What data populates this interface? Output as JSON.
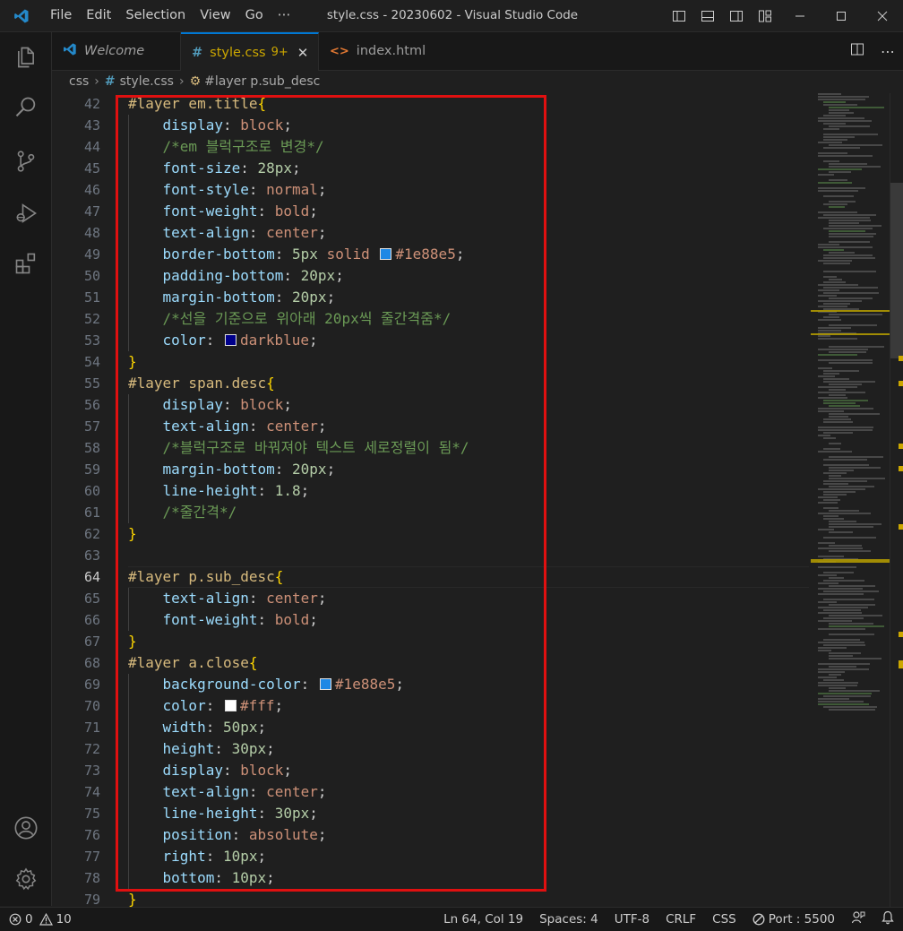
{
  "window": {
    "title": "style.css - 20230602 - Visual Studio Code"
  },
  "menu": [
    "File",
    "Edit",
    "Selection",
    "View",
    "Go",
    "⋯"
  ],
  "tabs": [
    {
      "label": "Welcome",
      "icon": "vscode-icon",
      "active": false,
      "italic": true
    },
    {
      "label": "style.css",
      "icon": "#",
      "badge": "9+",
      "active": true
    },
    {
      "label": "index.html",
      "icon": "<>",
      "active": false
    }
  ],
  "breadcrumb": [
    "css",
    "style.css",
    "#layer p.sub_desc"
  ],
  "editor": {
    "current_line": 64,
    "lines": [
      {
        "n": 42,
        "t": [
          [
            "sel",
            "#layer em.title"
          ],
          [
            "brace",
            "{"
          ]
        ]
      },
      {
        "n": 43,
        "t": [
          [
            "sp",
            "    "
          ],
          [
            "prop",
            "display"
          ],
          [
            "pl",
            ": "
          ],
          [
            "val",
            "block"
          ],
          [
            "pl",
            ";"
          ]
        ]
      },
      {
        "n": 44,
        "t": [
          [
            "sp",
            "    "
          ],
          [
            "cmt",
            "/*em 블럭구조로 변경*/"
          ]
        ]
      },
      {
        "n": 45,
        "t": [
          [
            "sp",
            "    "
          ],
          [
            "prop",
            "font-size"
          ],
          [
            "pl",
            ": "
          ],
          [
            "num",
            "28px"
          ],
          [
            "pl",
            ";"
          ]
        ]
      },
      {
        "n": 46,
        "t": [
          [
            "sp",
            "    "
          ],
          [
            "prop",
            "font-style"
          ],
          [
            "pl",
            ": "
          ],
          [
            "val",
            "normal"
          ],
          [
            "pl",
            ";"
          ]
        ]
      },
      {
        "n": 47,
        "t": [
          [
            "sp",
            "    "
          ],
          [
            "prop",
            "font-weight"
          ],
          [
            "pl",
            ": "
          ],
          [
            "val",
            "bold"
          ],
          [
            "pl",
            ";"
          ]
        ]
      },
      {
        "n": 48,
        "t": [
          [
            "sp",
            "    "
          ],
          [
            "prop",
            "text-align"
          ],
          [
            "pl",
            ": "
          ],
          [
            "val",
            "center"
          ],
          [
            "pl",
            ";"
          ]
        ]
      },
      {
        "n": 49,
        "t": [
          [
            "sp",
            "    "
          ],
          [
            "prop",
            "border-bottom"
          ],
          [
            "pl",
            ": "
          ],
          [
            "num",
            "5px"
          ],
          [
            "pl",
            " "
          ],
          [
            "val",
            "solid"
          ],
          [
            "pl",
            " "
          ],
          [
            "sw",
            "#1e88e5"
          ],
          [
            "val",
            "#1e88e5"
          ],
          [
            "pl",
            ";"
          ]
        ]
      },
      {
        "n": 50,
        "t": [
          [
            "sp",
            "    "
          ],
          [
            "prop",
            "padding-bottom"
          ],
          [
            "pl",
            ": "
          ],
          [
            "num",
            "20px"
          ],
          [
            "pl",
            ";"
          ]
        ]
      },
      {
        "n": 51,
        "t": [
          [
            "sp",
            "    "
          ],
          [
            "prop",
            "margin-bottom"
          ],
          [
            "pl",
            ": "
          ],
          [
            "num",
            "20px"
          ],
          [
            "pl",
            ";"
          ]
        ]
      },
      {
        "n": 52,
        "t": [
          [
            "sp",
            "    "
          ],
          [
            "cmt",
            "/*선을 기준으로 위아래 20px씩 줄간격줌*/"
          ]
        ]
      },
      {
        "n": 53,
        "t": [
          [
            "sp",
            "    "
          ],
          [
            "prop",
            "color"
          ],
          [
            "pl",
            ": "
          ],
          [
            "sw",
            "#00008b"
          ],
          [
            "val",
            "darkblue"
          ],
          [
            "pl",
            ";"
          ]
        ]
      },
      {
        "n": 54,
        "t": [
          [
            "brace",
            "}"
          ]
        ]
      },
      {
        "n": 55,
        "t": [
          [
            "sel",
            "#layer span.desc"
          ],
          [
            "brace",
            "{"
          ]
        ]
      },
      {
        "n": 56,
        "t": [
          [
            "sp",
            "    "
          ],
          [
            "prop",
            "display"
          ],
          [
            "pl",
            ": "
          ],
          [
            "val",
            "block"
          ],
          [
            "pl",
            ";"
          ]
        ]
      },
      {
        "n": 57,
        "t": [
          [
            "sp",
            "    "
          ],
          [
            "prop",
            "text-align"
          ],
          [
            "pl",
            ": "
          ],
          [
            "val",
            "center"
          ],
          [
            "pl",
            ";"
          ]
        ]
      },
      {
        "n": 58,
        "t": [
          [
            "sp",
            "    "
          ],
          [
            "cmt",
            "/*블럭구조로 바꿔져야 텍스트 세로정렬이 됨*/"
          ]
        ]
      },
      {
        "n": 59,
        "t": [
          [
            "sp",
            "    "
          ],
          [
            "prop",
            "margin-bottom"
          ],
          [
            "pl",
            ": "
          ],
          [
            "num",
            "20px"
          ],
          [
            "pl",
            ";"
          ]
        ]
      },
      {
        "n": 60,
        "t": [
          [
            "sp",
            "    "
          ],
          [
            "prop",
            "line-height"
          ],
          [
            "pl",
            ": "
          ],
          [
            "num",
            "1.8"
          ],
          [
            "pl",
            ";"
          ]
        ]
      },
      {
        "n": 61,
        "t": [
          [
            "sp",
            "    "
          ],
          [
            "cmt",
            "/*줄간격*/"
          ]
        ]
      },
      {
        "n": 62,
        "t": [
          [
            "brace",
            "}"
          ]
        ]
      },
      {
        "n": 63,
        "t": []
      },
      {
        "n": 64,
        "t": [
          [
            "sel",
            "#layer p.sub_desc"
          ],
          [
            "brace",
            "{"
          ]
        ]
      },
      {
        "n": 65,
        "t": [
          [
            "sp",
            "    "
          ],
          [
            "prop",
            "text-align"
          ],
          [
            "pl",
            ": "
          ],
          [
            "val",
            "center"
          ],
          [
            "pl",
            ";"
          ]
        ]
      },
      {
        "n": 66,
        "t": [
          [
            "sp",
            "    "
          ],
          [
            "prop",
            "font-weight"
          ],
          [
            "pl",
            ": "
          ],
          [
            "val",
            "bold"
          ],
          [
            "pl",
            ";"
          ]
        ]
      },
      {
        "n": 67,
        "t": [
          [
            "brace",
            "}"
          ]
        ]
      },
      {
        "n": 68,
        "t": [
          [
            "sel",
            "#layer a.close"
          ],
          [
            "brace",
            "{"
          ]
        ]
      },
      {
        "n": 69,
        "t": [
          [
            "sp",
            "    "
          ],
          [
            "prop",
            "background-color"
          ],
          [
            "pl",
            ": "
          ],
          [
            "sw",
            "#1e88e5"
          ],
          [
            "val",
            "#1e88e5"
          ],
          [
            "pl",
            ";"
          ]
        ]
      },
      {
        "n": 70,
        "t": [
          [
            "sp",
            "    "
          ],
          [
            "prop",
            "color"
          ],
          [
            "pl",
            ": "
          ],
          [
            "sw",
            "#ffffff"
          ],
          [
            "val",
            "#fff"
          ],
          [
            "pl",
            ";"
          ]
        ]
      },
      {
        "n": 71,
        "t": [
          [
            "sp",
            "    "
          ],
          [
            "prop",
            "width"
          ],
          [
            "pl",
            ": "
          ],
          [
            "num",
            "50px"
          ],
          [
            "pl",
            ";"
          ]
        ]
      },
      {
        "n": 72,
        "t": [
          [
            "sp",
            "    "
          ],
          [
            "prop",
            "height"
          ],
          [
            "pl",
            ": "
          ],
          [
            "num",
            "30px"
          ],
          [
            "pl",
            ";"
          ]
        ]
      },
      {
        "n": 73,
        "t": [
          [
            "sp",
            "    "
          ],
          [
            "prop",
            "display"
          ],
          [
            "pl",
            ": "
          ],
          [
            "val",
            "block"
          ],
          [
            "pl",
            ";"
          ]
        ]
      },
      {
        "n": 74,
        "t": [
          [
            "sp",
            "    "
          ],
          [
            "prop",
            "text-align"
          ],
          [
            "pl",
            ": "
          ],
          [
            "val",
            "center"
          ],
          [
            "pl",
            ";"
          ]
        ]
      },
      {
        "n": 75,
        "t": [
          [
            "sp",
            "    "
          ],
          [
            "prop",
            "line-height"
          ],
          [
            "pl",
            ": "
          ],
          [
            "num",
            "30px"
          ],
          [
            "pl",
            ";"
          ]
        ]
      },
      {
        "n": 76,
        "t": [
          [
            "sp",
            "    "
          ],
          [
            "prop",
            "position"
          ],
          [
            "pl",
            ": "
          ],
          [
            "val",
            "absolute"
          ],
          [
            "pl",
            ";"
          ]
        ]
      },
      {
        "n": 77,
        "t": [
          [
            "sp",
            "    "
          ],
          [
            "prop",
            "right"
          ],
          [
            "pl",
            ": "
          ],
          [
            "num",
            "10px"
          ],
          [
            "pl",
            ";"
          ]
        ]
      },
      {
        "n": 78,
        "t": [
          [
            "sp",
            "    "
          ],
          [
            "prop",
            "bottom"
          ],
          [
            "pl",
            ": "
          ],
          [
            "num",
            "10px"
          ],
          [
            "pl",
            ";"
          ]
        ]
      },
      {
        "n": 79,
        "t": [
          [
            "brace",
            "}"
          ]
        ]
      }
    ]
  },
  "status": {
    "errors": "0",
    "warnings": "10",
    "position": "Ln 64, Col 19",
    "spaces": "Spaces: 4",
    "encoding": "UTF-8",
    "eol": "CRLF",
    "language": "CSS",
    "port": "Port : 5500"
  },
  "colors": {
    "accent": "#0078d4",
    "highlight_box": "#e01010"
  }
}
